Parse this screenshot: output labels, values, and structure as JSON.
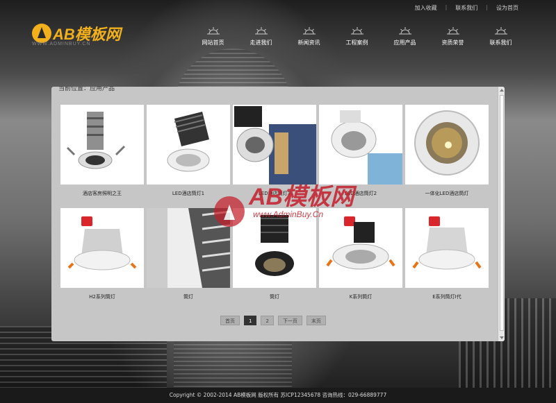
{
  "top_links": [
    "加入收藏",
    "联系我们",
    "设为首页"
  ],
  "logo": {
    "text": "AB模板网",
    "subtitle": "WWW.ADMINBUY.CN"
  },
  "nav": [
    {
      "label": "网站首页"
    },
    {
      "label": "走进我们"
    },
    {
      "label": "新闻资讯"
    },
    {
      "label": "工程案例"
    },
    {
      "label": "应用产品"
    },
    {
      "label": "资质荣誉"
    },
    {
      "label": "联系我们"
    }
  ],
  "panel": {
    "breadcrumb": "当前位置：应用产品"
  },
  "products": [
    {
      "name": "酒店客房照明之王"
    },
    {
      "name": "LED酒店筒灯1"
    },
    {
      "name": "LED酒店筒灯3"
    },
    {
      "name": "LED酒店筒灯2"
    },
    {
      "name": "一体化LED酒店筒灯"
    },
    {
      "name": "H2系列筒灯"
    },
    {
      "name": "筒灯"
    },
    {
      "name": "筒灯"
    },
    {
      "name": "K系列筒灯"
    },
    {
      "name": "E系列筒灯I代"
    }
  ],
  "pager": {
    "first": "首页",
    "page1": "1",
    "page2": "2",
    "next": "下一页",
    "last": "末页"
  },
  "watermark": {
    "text": "AB模板网",
    "url": "www.AdminBuy.Cn"
  },
  "footer": {
    "text": "Copyright © 2002-2014 AB模板网 版权所有 苏ICP12345678 咨询热线：029-66889777"
  },
  "colors": {
    "accent": "#f2b01c",
    "panel": "#c6c6c6",
    "footer": "#1a1a1a",
    "badge": "#d9262c"
  }
}
